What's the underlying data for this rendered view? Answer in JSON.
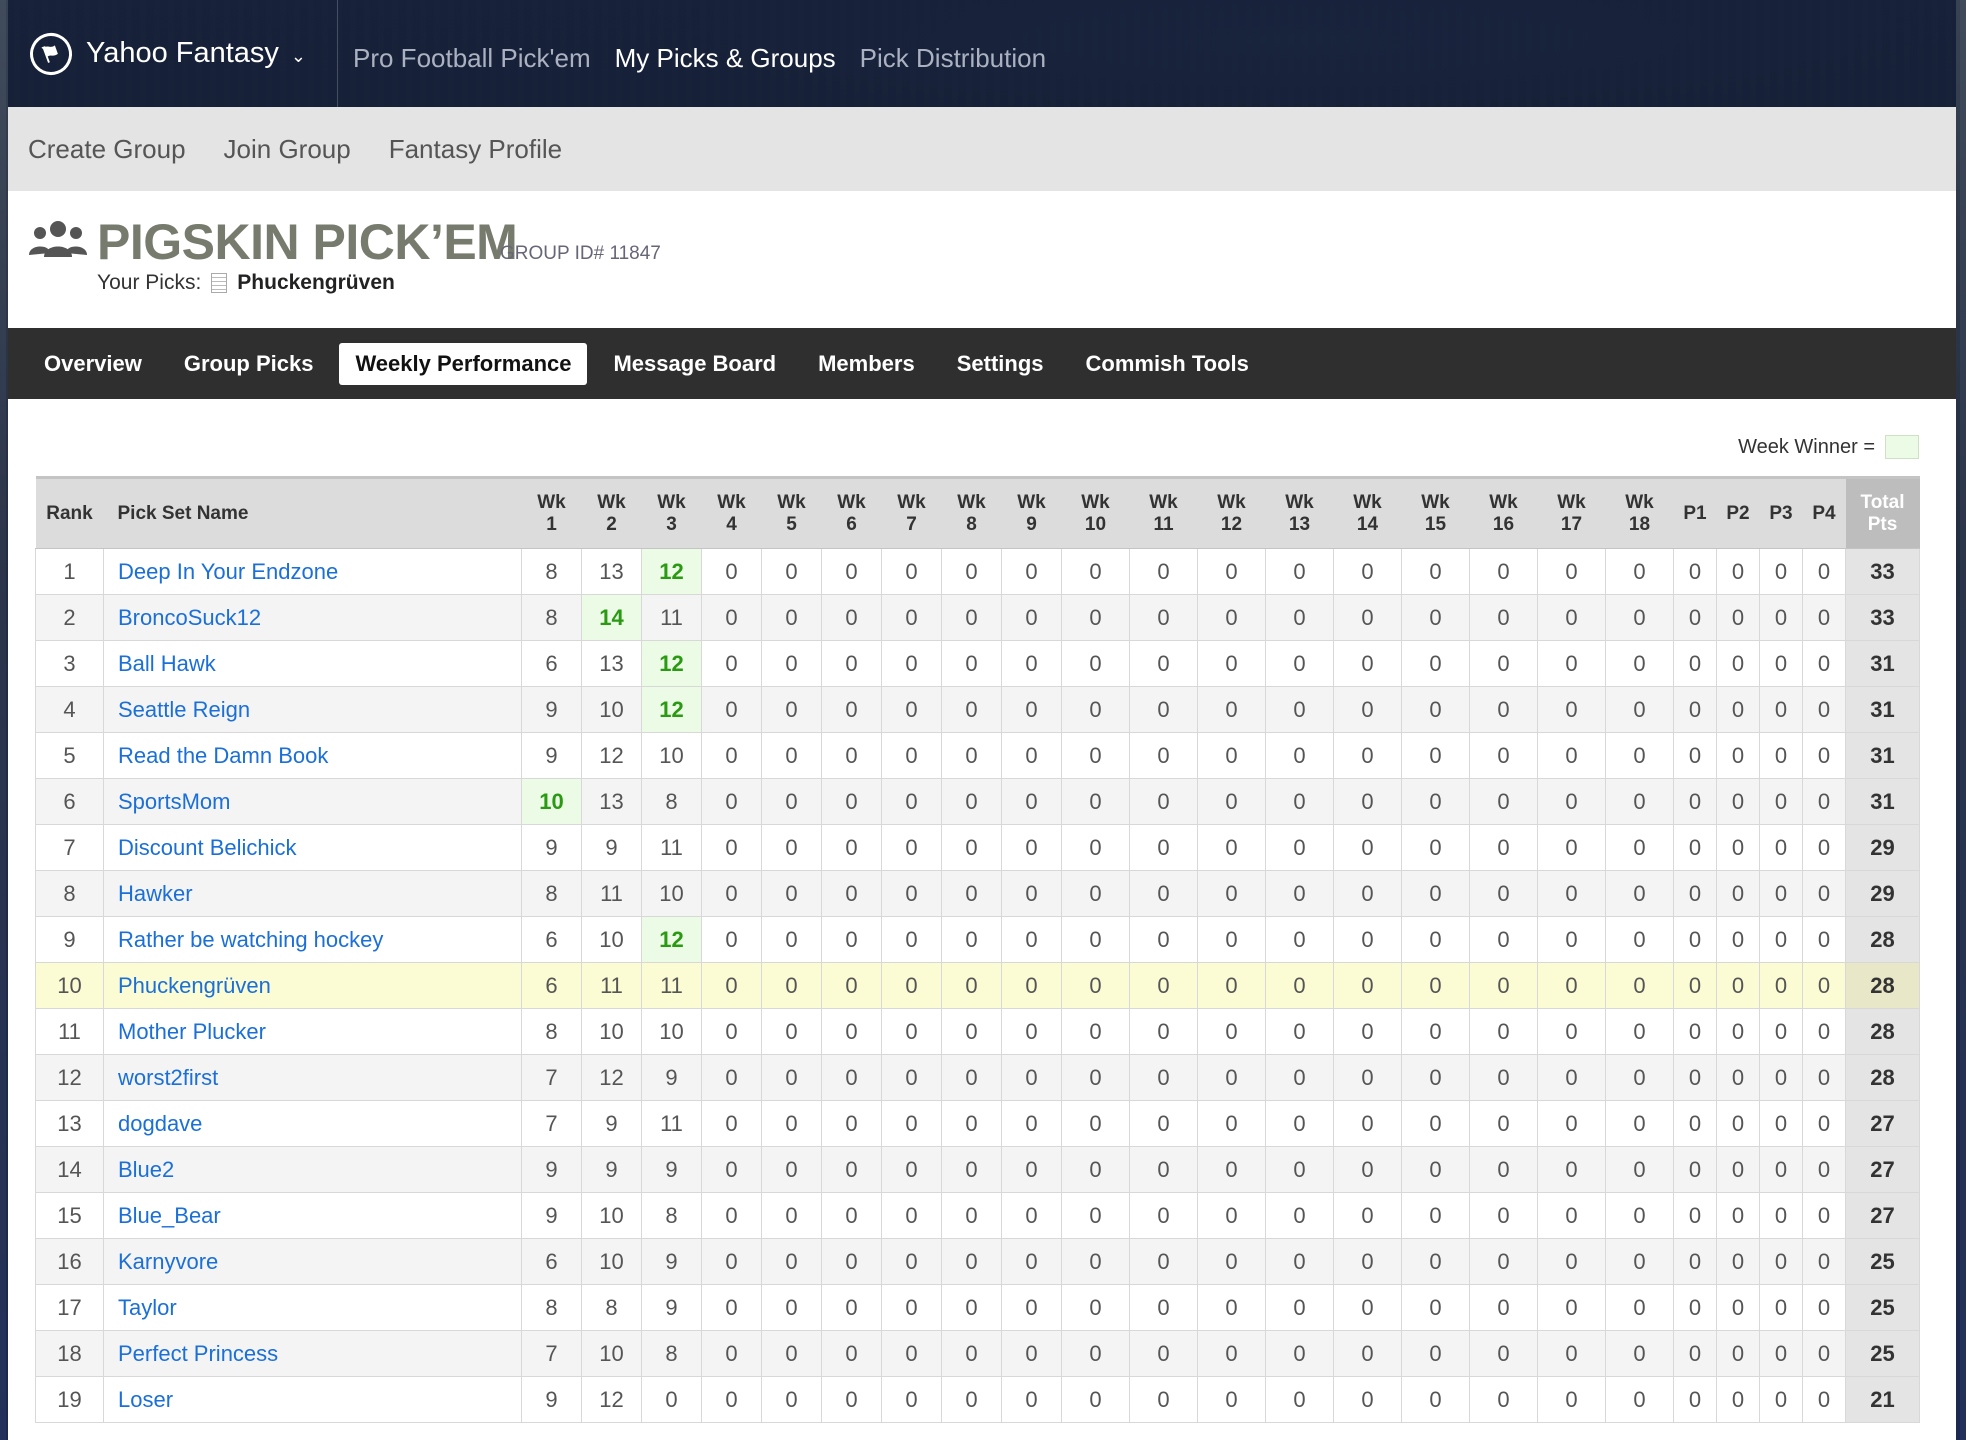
{
  "brand": {
    "name": "Yahoo Fantasy"
  },
  "topnav": [
    {
      "label": "Pro Football Pick'em",
      "active": false
    },
    {
      "label": "My Picks & Groups",
      "active": true
    },
    {
      "label": "Pick Distribution",
      "active": false
    }
  ],
  "subnav": [
    "Create Group",
    "Join Group",
    "Fantasy Profile"
  ],
  "group": {
    "title": "PIGSKIN PICK’EM",
    "id_label": "GROUP ID# 11847",
    "your_picks_label": "Your Picks:",
    "your_picks_name": "Phuckengrüven"
  },
  "tabs": [
    {
      "label": "Overview",
      "active": false
    },
    {
      "label": "Group Picks",
      "active": false
    },
    {
      "label": "Weekly Performance",
      "active": true
    },
    {
      "label": "Message Board",
      "active": false
    },
    {
      "label": "Members",
      "active": false
    },
    {
      "label": "Settings",
      "active": false
    },
    {
      "label": "Commish Tools",
      "active": false
    }
  ],
  "legend": {
    "label": "Week Winner ="
  },
  "table": {
    "columns": [
      {
        "l1": "Rank",
        "l2": ""
      },
      {
        "l1": "Pick Set Name",
        "l2": ""
      },
      {
        "l1": "Wk",
        "l2": "1"
      },
      {
        "l1": "Wk",
        "l2": "2"
      },
      {
        "l1": "Wk",
        "l2": "3"
      },
      {
        "l1": "Wk",
        "l2": "4"
      },
      {
        "l1": "Wk",
        "l2": "5"
      },
      {
        "l1": "Wk",
        "l2": "6"
      },
      {
        "l1": "Wk",
        "l2": "7"
      },
      {
        "l1": "Wk",
        "l2": "8"
      },
      {
        "l1": "Wk",
        "l2": "9"
      },
      {
        "l1": "Wk",
        "l2": "10"
      },
      {
        "l1": "Wk",
        "l2": "11"
      },
      {
        "l1": "Wk",
        "l2": "12"
      },
      {
        "l1": "Wk",
        "l2": "13"
      },
      {
        "l1": "Wk",
        "l2": "14"
      },
      {
        "l1": "Wk",
        "l2": "15"
      },
      {
        "l1": "Wk",
        "l2": "16"
      },
      {
        "l1": "Wk",
        "l2": "17"
      },
      {
        "l1": "Wk",
        "l2": "18"
      },
      {
        "l1": "P1",
        "l2": ""
      },
      {
        "l1": "P2",
        "l2": ""
      },
      {
        "l1": "P3",
        "l2": ""
      },
      {
        "l1": "P4",
        "l2": ""
      },
      {
        "l1": "Total",
        "l2": "Pts"
      }
    ],
    "rows": [
      {
        "rank": "1",
        "name": "Deep In Your Endzone",
        "weeks": [
          8,
          13,
          12,
          0,
          0,
          0,
          0,
          0,
          0,
          0,
          0,
          0,
          0,
          0,
          0,
          0,
          0,
          0
        ],
        "playoffs": [
          0,
          0,
          0,
          0
        ],
        "total": "33",
        "winners": [
          2
        ],
        "mine": false
      },
      {
        "rank": "2",
        "name": "BroncoSuck12",
        "weeks": [
          8,
          14,
          11,
          0,
          0,
          0,
          0,
          0,
          0,
          0,
          0,
          0,
          0,
          0,
          0,
          0,
          0,
          0
        ],
        "playoffs": [
          0,
          0,
          0,
          0
        ],
        "total": "33",
        "winners": [
          1
        ],
        "mine": false
      },
      {
        "rank": "3",
        "name": "Ball Hawk",
        "weeks": [
          6,
          13,
          12,
          0,
          0,
          0,
          0,
          0,
          0,
          0,
          0,
          0,
          0,
          0,
          0,
          0,
          0,
          0
        ],
        "playoffs": [
          0,
          0,
          0,
          0
        ],
        "total": "31",
        "winners": [
          2
        ],
        "mine": false
      },
      {
        "rank": "4",
        "name": "Seattle Reign",
        "weeks": [
          9,
          10,
          12,
          0,
          0,
          0,
          0,
          0,
          0,
          0,
          0,
          0,
          0,
          0,
          0,
          0,
          0,
          0
        ],
        "playoffs": [
          0,
          0,
          0,
          0
        ],
        "total": "31",
        "winners": [
          2
        ],
        "mine": false
      },
      {
        "rank": "5",
        "name": "Read the Damn Book",
        "weeks": [
          9,
          12,
          10,
          0,
          0,
          0,
          0,
          0,
          0,
          0,
          0,
          0,
          0,
          0,
          0,
          0,
          0,
          0
        ],
        "playoffs": [
          0,
          0,
          0,
          0
        ],
        "total": "31",
        "winners": [],
        "mine": false
      },
      {
        "rank": "6",
        "name": "SportsMom",
        "weeks": [
          10,
          13,
          8,
          0,
          0,
          0,
          0,
          0,
          0,
          0,
          0,
          0,
          0,
          0,
          0,
          0,
          0,
          0
        ],
        "playoffs": [
          0,
          0,
          0,
          0
        ],
        "total": "31",
        "winners": [
          0
        ],
        "mine": false
      },
      {
        "rank": "7",
        "name": "Discount Belichick",
        "weeks": [
          9,
          9,
          11,
          0,
          0,
          0,
          0,
          0,
          0,
          0,
          0,
          0,
          0,
          0,
          0,
          0,
          0,
          0
        ],
        "playoffs": [
          0,
          0,
          0,
          0
        ],
        "total": "29",
        "winners": [],
        "mine": false
      },
      {
        "rank": "8",
        "name": "Hawker",
        "weeks": [
          8,
          11,
          10,
          0,
          0,
          0,
          0,
          0,
          0,
          0,
          0,
          0,
          0,
          0,
          0,
          0,
          0,
          0
        ],
        "playoffs": [
          0,
          0,
          0,
          0
        ],
        "total": "29",
        "winners": [],
        "mine": false
      },
      {
        "rank": "9",
        "name": "Rather be watching hockey",
        "weeks": [
          6,
          10,
          12,
          0,
          0,
          0,
          0,
          0,
          0,
          0,
          0,
          0,
          0,
          0,
          0,
          0,
          0,
          0
        ],
        "playoffs": [
          0,
          0,
          0,
          0
        ],
        "total": "28",
        "winners": [
          2
        ],
        "mine": false
      },
      {
        "rank": "10",
        "name": "Phuckengrüven",
        "weeks": [
          6,
          11,
          11,
          0,
          0,
          0,
          0,
          0,
          0,
          0,
          0,
          0,
          0,
          0,
          0,
          0,
          0,
          0
        ],
        "playoffs": [
          0,
          0,
          0,
          0
        ],
        "total": "28",
        "winners": [],
        "mine": true
      },
      {
        "rank": "11",
        "name": "Mother Plucker",
        "weeks": [
          8,
          10,
          10,
          0,
          0,
          0,
          0,
          0,
          0,
          0,
          0,
          0,
          0,
          0,
          0,
          0,
          0,
          0
        ],
        "playoffs": [
          0,
          0,
          0,
          0
        ],
        "total": "28",
        "winners": [],
        "mine": false
      },
      {
        "rank": "12",
        "name": "worst2first",
        "weeks": [
          7,
          12,
          9,
          0,
          0,
          0,
          0,
          0,
          0,
          0,
          0,
          0,
          0,
          0,
          0,
          0,
          0,
          0
        ],
        "playoffs": [
          0,
          0,
          0,
          0
        ],
        "total": "28",
        "winners": [],
        "mine": false
      },
      {
        "rank": "13",
        "name": "dogdave",
        "weeks": [
          7,
          9,
          11,
          0,
          0,
          0,
          0,
          0,
          0,
          0,
          0,
          0,
          0,
          0,
          0,
          0,
          0,
          0
        ],
        "playoffs": [
          0,
          0,
          0,
          0
        ],
        "total": "27",
        "winners": [],
        "mine": false
      },
      {
        "rank": "14",
        "name": "Blue2",
        "weeks": [
          9,
          9,
          9,
          0,
          0,
          0,
          0,
          0,
          0,
          0,
          0,
          0,
          0,
          0,
          0,
          0,
          0,
          0
        ],
        "playoffs": [
          0,
          0,
          0,
          0
        ],
        "total": "27",
        "winners": [],
        "mine": false
      },
      {
        "rank": "15",
        "name": "Blue_Bear",
        "weeks": [
          9,
          10,
          8,
          0,
          0,
          0,
          0,
          0,
          0,
          0,
          0,
          0,
          0,
          0,
          0,
          0,
          0,
          0
        ],
        "playoffs": [
          0,
          0,
          0,
          0
        ],
        "total": "27",
        "winners": [],
        "mine": false
      },
      {
        "rank": "16",
        "name": "Karnyvore",
        "weeks": [
          6,
          10,
          9,
          0,
          0,
          0,
          0,
          0,
          0,
          0,
          0,
          0,
          0,
          0,
          0,
          0,
          0,
          0
        ],
        "playoffs": [
          0,
          0,
          0,
          0
        ],
        "total": "25",
        "winners": [],
        "mine": false
      },
      {
        "rank": "17",
        "name": "Taylor",
        "weeks": [
          8,
          8,
          9,
          0,
          0,
          0,
          0,
          0,
          0,
          0,
          0,
          0,
          0,
          0,
          0,
          0,
          0,
          0
        ],
        "playoffs": [
          0,
          0,
          0,
          0
        ],
        "total": "25",
        "winners": [],
        "mine": false
      },
      {
        "rank": "18",
        "name": "Perfect Princess",
        "weeks": [
          7,
          10,
          8,
          0,
          0,
          0,
          0,
          0,
          0,
          0,
          0,
          0,
          0,
          0,
          0,
          0,
          0,
          0
        ],
        "playoffs": [
          0,
          0,
          0,
          0
        ],
        "total": "25",
        "winners": [],
        "mine": false
      },
      {
        "rank": "19",
        "name": "Loser",
        "weeks": [
          9,
          12,
          0,
          0,
          0,
          0,
          0,
          0,
          0,
          0,
          0,
          0,
          0,
          0,
          0,
          0,
          0,
          0
        ],
        "playoffs": [
          0,
          0,
          0,
          0
        ],
        "total": "21",
        "winners": [],
        "mine": false
      }
    ]
  }
}
